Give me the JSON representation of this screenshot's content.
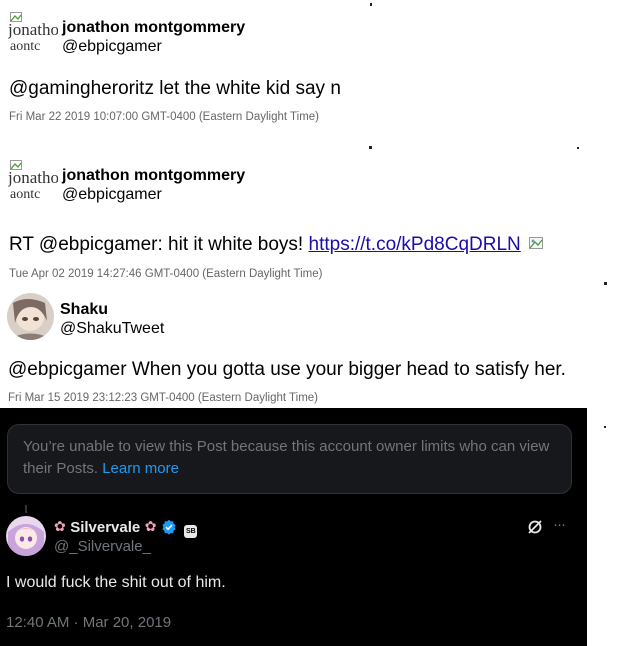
{
  "posts": [
    {
      "avatar_alt": "jonathon montgommery",
      "name": "jonathon montgommery",
      "handle": "@ebpicgamer",
      "text": "@gamingheroritz let the white kid say n",
      "link": "",
      "timestamp": "Fri Mar 22 2019 10:07:00 GMT-0400 (Eastern Daylight Time)"
    },
    {
      "avatar_alt": "jonathon montgommery",
      "name": "jonathon montgommery",
      "handle": "@ebpicgamer",
      "text": "RT @ebpicgamer: hit it white boys! ",
      "link": "https://t.co/kPd8CqDRLN",
      "timestamp": "Tue Apr 02 2019 14:27:46 GMT-0400 (Eastern Daylight Time)"
    },
    {
      "name": "Shaku",
      "handle": "@ShakuTweet",
      "text": "@ebpicgamer When you gotta use your bigger head to satisfy her.",
      "timestamp": "Fri Mar 15 2019 23:12:23 GMT-0400 (Eastern Daylight Time)"
    }
  ],
  "notice": {
    "text": "You’re unable to view this Post because this account owner limits who can view their Posts. ",
    "link": "Learn more"
  },
  "reply": {
    "name": "Silvervale",
    "handle": "@_Silvervale_",
    "text": "I would fuck the shit out of him.",
    "timestamp": "12:40 AM · Mar 20, 2019",
    "more_label": "···",
    "affiliate_badge": "SB"
  },
  "colors": {
    "dark_bg": "#000000",
    "link_blue": "#1a0dab",
    "x_blue": "#1d9bf0",
    "muted": "#71767b"
  }
}
